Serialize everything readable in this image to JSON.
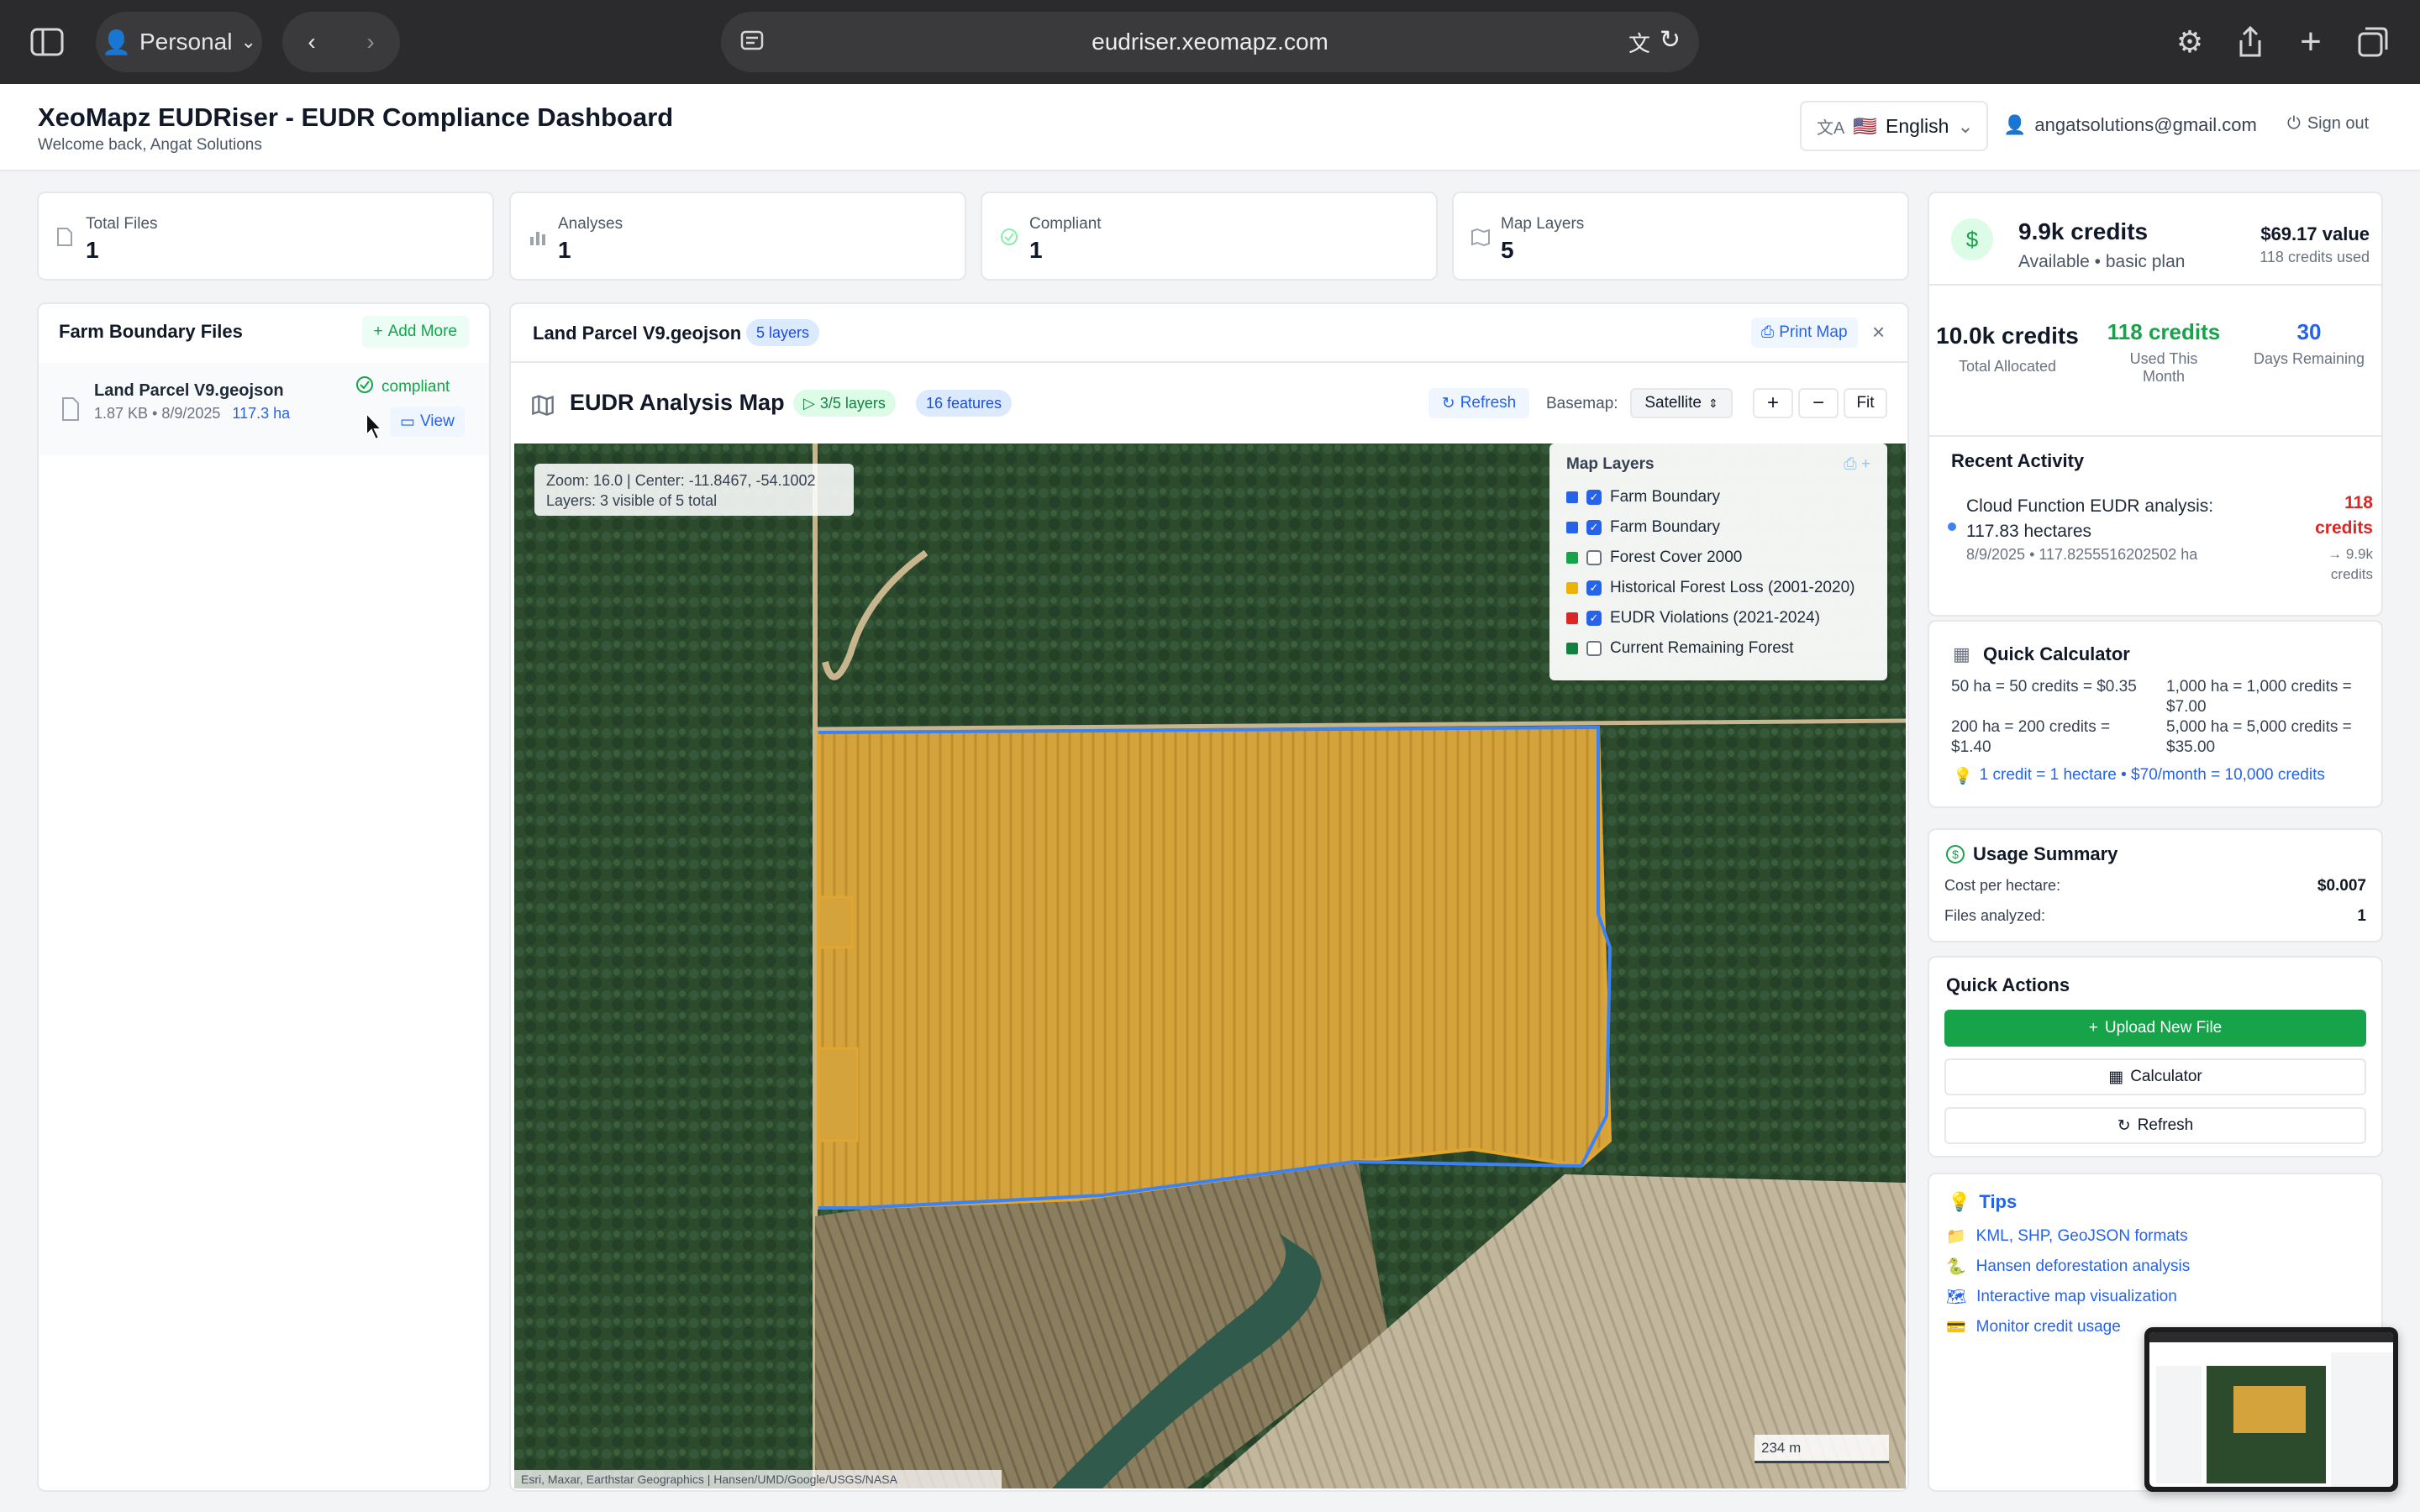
{
  "browser": {
    "profile": "Personal",
    "url": "eudriser.xeomapz.com"
  },
  "header": {
    "title": "XeoMapz EUDRiser - EUDR Compliance Dashboard",
    "subtitle": "Welcome back, Angat Solutions",
    "language": "English",
    "language_flag": "🇺🇸",
    "email": "angatsolutions@gmail.com",
    "signout": "Sign out"
  },
  "stats": [
    {
      "label": "Total Files",
      "value": "1",
      "icon": "file-icon"
    },
    {
      "label": "Analyses",
      "value": "1",
      "icon": "bar-chart-icon"
    },
    {
      "label": "Compliant",
      "value": "1",
      "icon": "check-circle-icon"
    },
    {
      "label": "Map Layers",
      "value": "5",
      "icon": "map-icon"
    }
  ],
  "files_panel": {
    "title": "Farm Boundary Files",
    "add_more": "Add More",
    "files": [
      {
        "name": "Land Parcel V9.geojson",
        "size": "1.87 KB",
        "date": "8/9/2025",
        "meta": "1.87 KB • 8/9/2025",
        "area": "117.3 ha",
        "status": "compliant",
        "view": "View"
      }
    ]
  },
  "map_panel": {
    "file_name": "Land Parcel V9.geojson",
    "layers_badge": "5 layers",
    "print": "Print Map",
    "map_title": "EUDR Analysis Map",
    "visible_layers": "3/5 layers",
    "features": "16 features",
    "refresh": "Refresh",
    "basemap_label": "Basemap:",
    "basemap_value": "Satellite",
    "zoom_in": "+",
    "zoom_out": "−",
    "fit": "Fit",
    "info_line1": "Zoom: 16.0 | Center: -11.8467, -54.1002",
    "info_line2": "Layers: 3 visible of 5 total",
    "scale": "234 m",
    "attribution": "Esri, Maxar, Earthstar Geographics | Hansen/UMD/Google/USGS/NASA",
    "legend_title": "Map Layers",
    "layers": [
      {
        "name": "Farm Boundary",
        "color": "#2563eb",
        "checked": true
      },
      {
        "name": "Farm Boundary",
        "color": "#2563eb",
        "checked": true
      },
      {
        "name": "Forest Cover 2000",
        "color": "#16a34a",
        "checked": false
      },
      {
        "name": "Historical Forest Loss (2001-2020)",
        "color": "#eab308",
        "checked": true
      },
      {
        "name": "EUDR Violations (2021-2024)",
        "color": "#dc2626",
        "checked": true
      },
      {
        "name": "Current Remaining Forest",
        "color": "#15803d",
        "checked": false
      }
    ]
  },
  "credits": {
    "headline": "9.9k credits",
    "plan": "Available • basic plan",
    "value": "$69.17 value",
    "used_note": "118 credits used",
    "allocated_value": "10.0k credits",
    "allocated_label": "Total Allocated",
    "used_value": "118 credits",
    "used_label": "Used This Month",
    "days_value": "30",
    "days_label": "Days Remaining",
    "recent_title": "Recent Activity",
    "activity_title": "Cloud Function EUDR analysis: 117.83 hectares",
    "activity_meta": "8/9/2025 • 117.8255516202502 ha",
    "activity_credits": "118 credits",
    "activity_balance": "→ 9.9k credits"
  },
  "calculator": {
    "title": "Quick Calculator",
    "rows": [
      "50 ha = 50 credits = $0.35",
      "1,000 ha = 1,000 credits = $7.00",
      "200 ha = 200 credits = $1.40",
      "5,000 ha = 5,000 credits = $35.00"
    ],
    "note": "1 credit = 1 hectare • $70/month = 10,000 credits"
  },
  "usage": {
    "title": "Usage Summary",
    "cost_label": "Cost per hectare:",
    "cost_value": "$0.007",
    "files_label": "Files analyzed:",
    "files_value": "1"
  },
  "quick_actions": {
    "title": "Quick Actions",
    "upload": "Upload New File",
    "calculator": "Calculator",
    "refresh": "Refresh"
  },
  "tips": {
    "title": "Tips",
    "items": [
      {
        "text": "KML, SHP, GeoJSON formats",
        "icon": "📁"
      },
      {
        "text": "Hansen deforestation analysis",
        "icon": "🐍"
      },
      {
        "text": "Interactive map visualization",
        "icon": "🗺"
      },
      {
        "text": "Monitor credit usage",
        "icon": "💳"
      }
    ]
  },
  "colors": {
    "accent_green": "#16a34a",
    "accent_blue": "#2563eb",
    "danger": "#dc2626",
    "parcel_fill": "#d4a73a"
  }
}
